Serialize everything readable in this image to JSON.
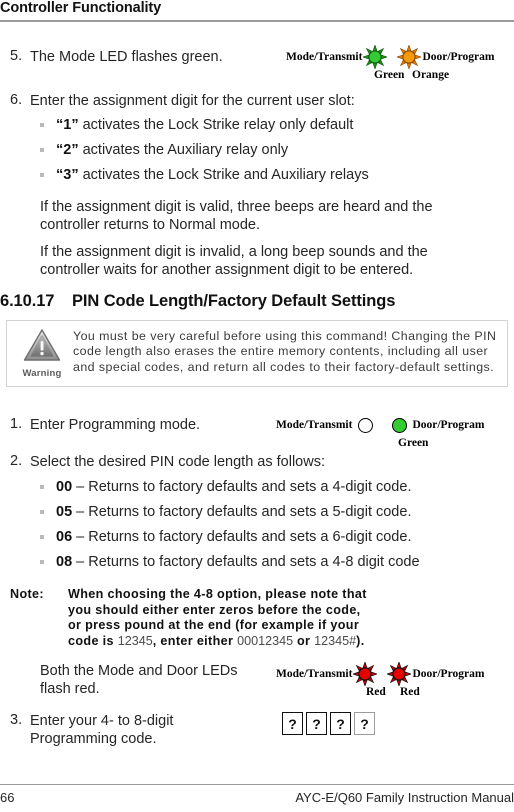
{
  "running_head": "Controller Functionality",
  "steps": {
    "step5": {
      "num": "5.",
      "text": "The Mode LED flashes green."
    },
    "step6": {
      "num": "6.",
      "text": "Enter the assignment digit for the current user slot:"
    },
    "step1b": {
      "num": "1.",
      "text": "Enter Programming mode."
    },
    "step2b": {
      "num": "2.",
      "text": "Select the desired PIN code length as follows:"
    },
    "step3b": {
      "num": "3.",
      "text": "Enter your 4- to 8-digit Programming code."
    }
  },
  "assignment_bullets": [
    {
      "code": "“1”",
      "rest": " activates the Lock Strike relay only default"
    },
    {
      "code": "“2”",
      "rest": " activates the Auxiliary relay only"
    },
    {
      "code": "“3”",
      "rest": " activates the Lock Strike and Auxiliary relays"
    }
  ],
  "paragraphs": {
    "valid": "If the assignment digit is valid, three beeps are heard and the controller returns to Normal mode.",
    "invalid": "If the assignment digit is invalid, a long beep sounds and the controller waits for another assignment digit to be entered.",
    "both_leds": "Both the Mode and Door LEDs flash red."
  },
  "section": {
    "number": "6.10.17",
    "title": "PIN Code Length/Factory Default Settings"
  },
  "warning": {
    "label": "Warning",
    "icon": "warning-triangle-icon",
    "text": "You must be very careful before using this command! Changing the PIN code length also erases the entire memory contents, including all user and special codes, and return all codes to their factory-default settings."
  },
  "pin_length_bullets": [
    {
      "code": "00",
      "rest": " – Returns to factory defaults and sets a 4-digit code."
    },
    {
      "code": "05",
      "rest": " – Returns to factory defaults and sets a 5-digit code."
    },
    {
      "code": "06",
      "rest": " – Returns to factory defaults and sets a 6-digit code."
    },
    {
      "code": "08",
      "rest": " – Returns to factory defaults and sets a 4-8 digit code"
    }
  ],
  "note": {
    "label": "Note:",
    "part1": "When choosing the 4-8 option, please note that you should either enter zeros before the code, or press pound at the end (for example if your code is ",
    "code1": "12345",
    "part2": ", enter either ",
    "code2": "00012345",
    "part3": " or ",
    "code3": "12345#",
    "part4": ")."
  },
  "led_diagrams": {
    "green_orange": {
      "left_label": "Mode/Transmit",
      "right_label": "Door/Program",
      "left_sub": "Green",
      "right_sub": "Orange",
      "left_color": "#33cc33",
      "right_color": "#f59a0b",
      "style": "burst"
    },
    "off_green": {
      "left_label": "Mode/Transmit",
      "right_label": "Door/Program",
      "right_sub": "Green",
      "right_color": "#33cc33",
      "style": "dot"
    },
    "red_red": {
      "left_label": "Mode/Transmit",
      "right_label": "Door/Program",
      "left_sub": "Red",
      "right_sub": "Red",
      "left_color": "#e60000",
      "right_color": "#e60000",
      "style": "burst"
    }
  },
  "keypad": {
    "keys": [
      "?",
      "?",
      "?",
      "?"
    ]
  },
  "footer": {
    "page_number": "66",
    "manual_title": "AYC-E/Q60 Family Instruction Manual"
  }
}
